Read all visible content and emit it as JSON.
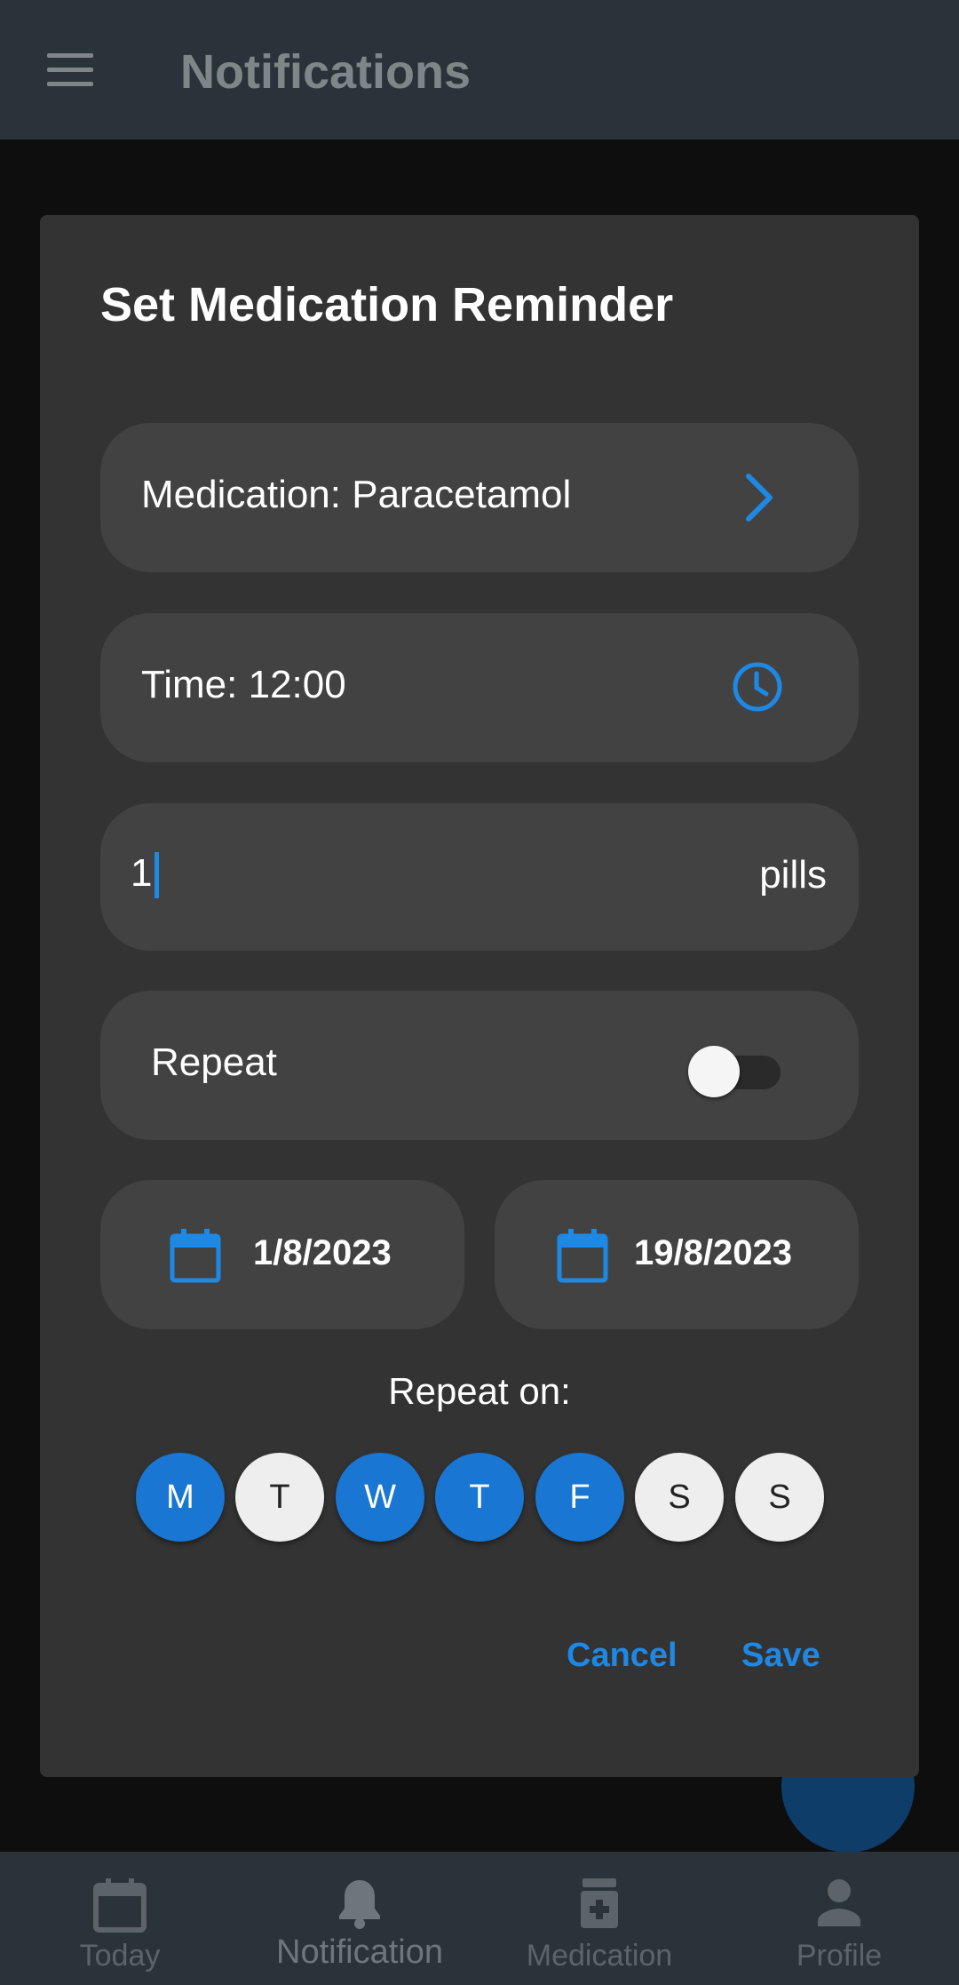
{
  "appbar": {
    "title": "Notifications",
    "menu_icon": "menu-icon"
  },
  "dialog": {
    "title": "Set Medication Reminder",
    "medication_label": "Medication: Paracetamol",
    "time_label": "Time: 12:00",
    "quantity_value": "1",
    "quantity_suffix": "pills",
    "repeat_label": "Repeat",
    "repeat_enabled": false,
    "start_date": "1/8/2023",
    "end_date": "19/8/2023",
    "repeat_on_label": "Repeat on:",
    "days": [
      {
        "label": "M",
        "selected": true
      },
      {
        "label": "T",
        "selected": false
      },
      {
        "label": "W",
        "selected": true
      },
      {
        "label": "T",
        "selected": true
      },
      {
        "label": "F",
        "selected": true
      },
      {
        "label": "S",
        "selected": false
      },
      {
        "label": "S",
        "selected": false
      }
    ],
    "cancel_label": "Cancel",
    "save_label": "Save"
  },
  "bottom_nav": {
    "items": [
      {
        "label": "Today",
        "icon": "calendar-icon"
      },
      {
        "label": "Notification",
        "icon": "bell-icon",
        "active": true
      },
      {
        "label": "Medication",
        "icon": "medication-icon"
      },
      {
        "label": "Profile",
        "icon": "person-icon"
      }
    ]
  },
  "colors": {
    "accent": "#1e88e5",
    "day_selected": "#1976d2",
    "appbar": "#2a3339",
    "dialog": "#333333",
    "field": "#424242"
  }
}
